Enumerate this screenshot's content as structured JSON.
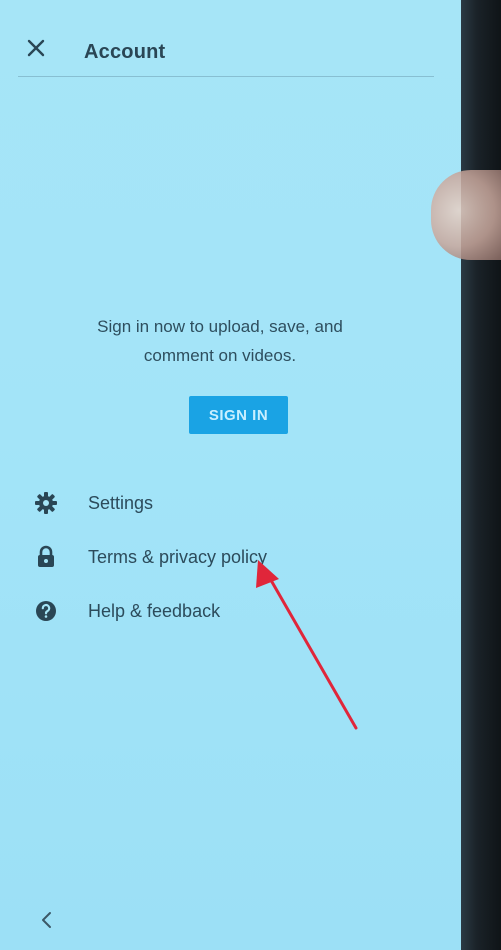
{
  "header": {
    "title": "Account"
  },
  "main": {
    "message": "Sign in now to upload, save, and comment on videos.",
    "signin_label": "SIGN IN"
  },
  "menu": {
    "items": [
      {
        "label": "Settings",
        "icon": "gear-icon"
      },
      {
        "label": "Terms & privacy policy",
        "icon": "lock-icon"
      },
      {
        "label": "Help & feedback",
        "icon": "help-icon"
      }
    ]
  },
  "colors": {
    "background": "#a6e5f7",
    "accent": "#1aa3e4",
    "text": "#2c4b5b",
    "annotation_arrow": "#e0263a"
  },
  "icons": {
    "close": "close-icon",
    "back": "chevron-left-icon"
  }
}
